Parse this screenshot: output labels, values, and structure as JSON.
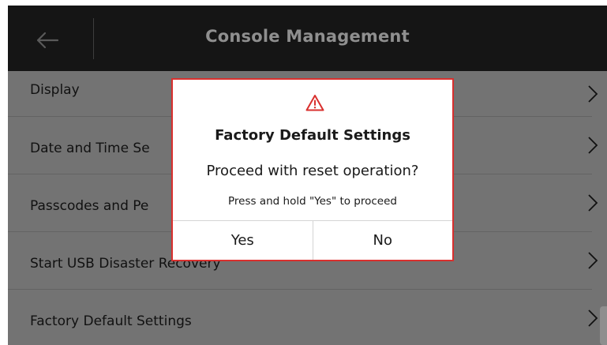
{
  "header": {
    "title": "Console Management",
    "back_icon": "arrow-left-icon"
  },
  "menu": {
    "items": [
      {
        "label": "Display",
        "icon": "chevron-right-icon"
      },
      {
        "label": "Date and Time Se",
        "icon": "chevron-right-icon"
      },
      {
        "label": "Passcodes and Pe",
        "icon": "chevron-right-icon"
      },
      {
        "label": "Start USB Disaster Recovery",
        "icon": "chevron-right-icon"
      },
      {
        "label": "Factory Default Settings",
        "icon": "chevron-right-icon"
      }
    ]
  },
  "dialog": {
    "icon": "warning-icon",
    "title": "Factory Default Settings",
    "question": "Proceed with reset operation?",
    "hint": "Press and hold \"Yes\" to proceed",
    "yes_label": "Yes",
    "no_label": "No"
  },
  "colors": {
    "header_bg": "#151515",
    "overlay_bg": "#737373",
    "dialog_border": "#d9302e",
    "warning_icon": "#d9302e"
  }
}
